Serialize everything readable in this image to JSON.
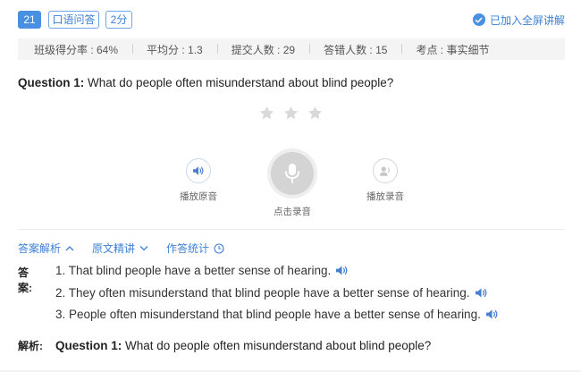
{
  "header": {
    "question_number": "21",
    "type_tag": "口语问答",
    "score_tag": "2分",
    "fullscreen_label": "已加入全屏讲解"
  },
  "stats": [
    "班级得分率 : 64%",
    "平均分 : 1.3",
    "提交人数 : 29",
    "答错人数 : 15",
    "考点 : 事实细节"
  ],
  "question": {
    "label": "Question 1:",
    "text": "What do people often misunderstand about blind people?"
  },
  "rating": {
    "stars": 3,
    "filled": 0
  },
  "controls": {
    "play_original": "播放原音",
    "record": "点击录音",
    "play_recording": "播放录音"
  },
  "tabs": {
    "analysis": "答案解析",
    "original": "原文精讲",
    "stats": "作答统计"
  },
  "answers": {
    "label": "答案:",
    "items": [
      "1. That blind people have a better sense of hearing.",
      "2. They often misunderstand that blind people have a better sense of hearing.",
      "3. People often misunderstand that blind people have a better sense of hearing."
    ]
  },
  "analysis": {
    "label": "解析:",
    "question_label": "Question 1:",
    "question_text": "What do people often misunderstand about blind people?"
  },
  "colors": {
    "accent": "#4a90e2",
    "link": "#3d7fd6",
    "stats_bg": "#f4f4f4",
    "star": "#d9d9d9"
  }
}
